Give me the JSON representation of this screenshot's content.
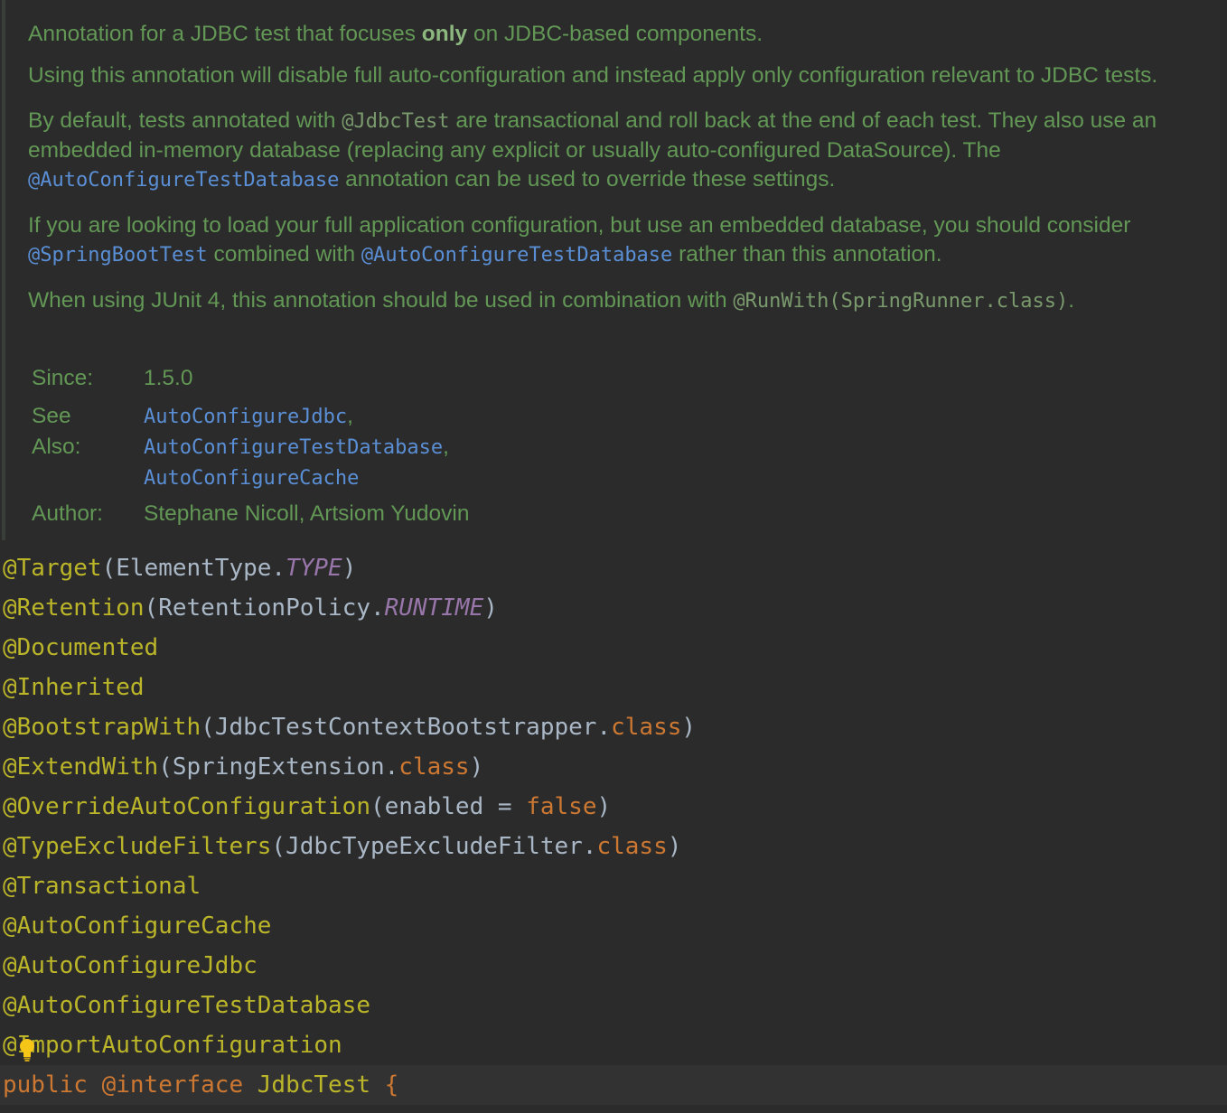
{
  "doc": {
    "para1": {
      "before": "Annotation for a JDBC test that focuses ",
      "bold": "only",
      "after": " on JDBC-based components."
    },
    "para2": "Using this annotation will disable full auto-configuration and instead apply only configuration relevant to JDBC tests.",
    "para3": {
      "t1": "By default, tests annotated with ",
      "code1": "@JdbcTest",
      "t2": " are transactional and roll back at the end of each test. They also use an embedded in-memory database (replacing any explicit or usually auto-configured DataSource). The ",
      "link1": "@AutoConfigureTestDatabase",
      "t3": " annotation can be used to override these settings."
    },
    "para4": {
      "t1": "If you are looking to load your full application configuration, but use an embedded database, you should consider ",
      "link1": "@SpringBootTest",
      "t2": " combined with ",
      "link2": "@AutoConfigureTestDatabase",
      "t3": " rather than this annotation."
    },
    "para5": {
      "t1": "When using JUnit 4, this annotation should be used in combination with ",
      "code1": "@RunWith(SpringRunner.class)",
      "t2": "."
    },
    "since_label": "Since:",
    "since_value": "1.5.0",
    "see_also_label": "See Also:",
    "see_also": [
      "AutoConfigureJdbc",
      "AutoConfigureTestDatabase",
      "AutoConfigureCache"
    ],
    "author_label": "Author:",
    "author_value": "Stephane Nicoll, Artsiom Yudovin"
  },
  "code": {
    "target": {
      "ann": "@Target",
      "open": "(",
      "cls": "ElementType.",
      "enum": "TYPE",
      "close": ")"
    },
    "retention": {
      "ann": "@Retention",
      "open": "(",
      "cls": "RetentionPolicy.",
      "enum": "RUNTIME",
      "close": ")"
    },
    "documented": "@Documented",
    "inherited": "@Inherited",
    "bootstrap": {
      "ann": "@BootstrapWith",
      "open": "(",
      "cls": "JdbcTestContextBootstrapper.",
      "kw": "class",
      "close": ")"
    },
    "extend": {
      "ann": "@ExtendWith",
      "open": "(",
      "cls": "SpringExtension.",
      "kw": "class",
      "close": ")"
    },
    "override": {
      "ann": "@OverrideAutoConfiguration",
      "open": "(",
      "cls": "enabled = ",
      "kw": "false",
      "close": ")"
    },
    "typeexclude": {
      "ann": "@TypeExcludeFilters",
      "open": "(",
      "cls": "JdbcTypeExcludeFilter.",
      "kw": "class",
      "close": ")"
    },
    "transactional": "@Transactional",
    "cache": "@AutoConfigureCache",
    "jdbc": "@AutoConfigureJdbc",
    "testdb": "@AutoConfigureTestDatabase",
    "importauto": "@ImportAutoConfiguration",
    "decl": {
      "public": "public",
      "interface": "@interface",
      "name": "JdbcTest",
      "brace": "{"
    }
  },
  "colors": {
    "background": "#2b2b2b",
    "doc_text": "#629755",
    "link": "#5a8fd6",
    "annotation": "#bbb529",
    "keyword": "#cc7832",
    "enum_constant": "#9876aa",
    "identifier": "#a9b7c6"
  },
  "icons": [
    "lightbulb-icon"
  ]
}
